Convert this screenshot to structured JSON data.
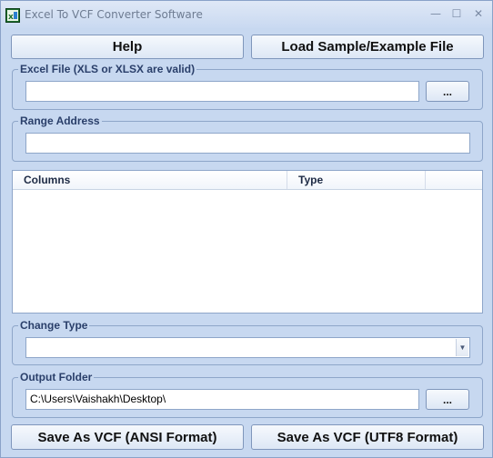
{
  "window": {
    "title": "Excel To VCF Converter Software",
    "minimize_glyph": "—",
    "maximize_glyph": "☐",
    "close_glyph": "✕"
  },
  "toolbar": {
    "help_label": "Help",
    "load_sample_label": "Load Sample/Example File"
  },
  "excel_file": {
    "group_label": "Excel File (XLS or XLSX are valid)",
    "value": "",
    "browse_label": "..."
  },
  "range_address": {
    "group_label": "Range Address",
    "value": ""
  },
  "columns_list": {
    "headers": [
      "Columns",
      "Type"
    ],
    "rows": []
  },
  "change_type": {
    "group_label": "Change Type",
    "selected": ""
  },
  "output_folder": {
    "group_label": "Output Folder",
    "value": "C:\\Users\\Vaishakh\\Desktop\\",
    "browse_label": "..."
  },
  "actions": {
    "save_ansi_label": "Save As VCF (ANSI Format)",
    "save_utf8_label": "Save As VCF (UTF8 Format)"
  },
  "colors": {
    "window_bg": "#c7d8f0",
    "group_label": "#2a3f6a",
    "border": "#8ea6c9"
  }
}
